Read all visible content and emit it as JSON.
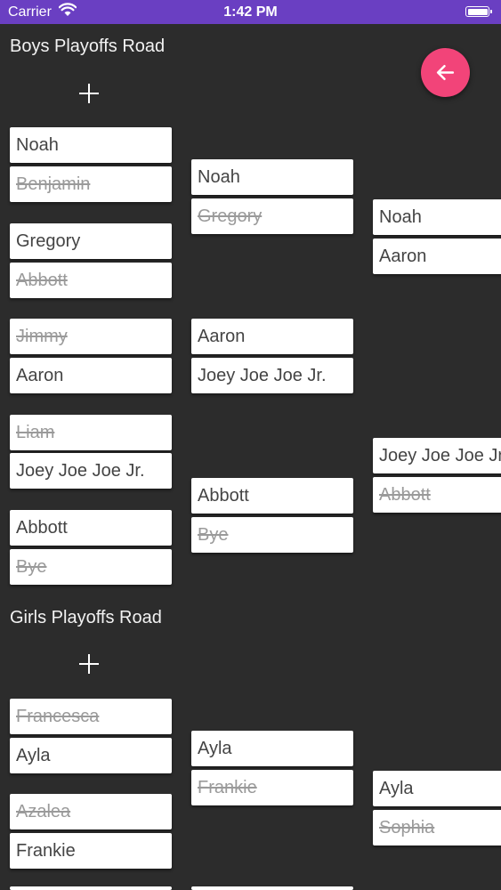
{
  "status_bar": {
    "carrier": "Carrier",
    "time": "1:42 PM"
  },
  "boys": {
    "title": "Boys Playoffs Road",
    "round1": [
      {
        "name": "Noah",
        "lost": false
      },
      {
        "name": "Benjamin",
        "lost": true
      },
      {
        "name": "Gregory",
        "lost": false
      },
      {
        "name": "Abbott",
        "lost": true
      },
      {
        "name": "Jimmy",
        "lost": true
      },
      {
        "name": "Aaron",
        "lost": false
      },
      {
        "name": "Liam",
        "lost": true
      },
      {
        "name": "Joey Joe Joe Jr.",
        "lost": false
      },
      {
        "name": "Abbott",
        "lost": false
      },
      {
        "name": "Bye",
        "lost": true
      }
    ],
    "round2": [
      {
        "name": "Noah",
        "lost": false
      },
      {
        "name": "Gregory",
        "lost": true
      },
      {
        "name": "Aaron",
        "lost": false
      },
      {
        "name": "Joey Joe Joe Jr.",
        "lost": false
      },
      {
        "name": "Abbott",
        "lost": false
      },
      {
        "name": "Bye",
        "lost": true
      }
    ],
    "round3": [
      {
        "name": "Noah",
        "lost": false
      },
      {
        "name": "Aaron",
        "lost": false
      },
      {
        "name": "Joey Joe Joe Jr.",
        "lost": false
      },
      {
        "name": "Abbott",
        "lost": true
      }
    ]
  },
  "girls": {
    "title": "Girls Playoffs Road",
    "round1": [
      {
        "name": "Francesca",
        "lost": true
      },
      {
        "name": "Ayla",
        "lost": false
      },
      {
        "name": "Azalea",
        "lost": true
      },
      {
        "name": "Frankie",
        "lost": false
      }
    ],
    "round2": [
      {
        "name": "Ayla",
        "lost": false
      },
      {
        "name": "Frankie",
        "lost": true
      }
    ],
    "round3": [
      {
        "name": "Ayla",
        "lost": false
      },
      {
        "name": "Sophia",
        "lost": true
      }
    ]
  }
}
